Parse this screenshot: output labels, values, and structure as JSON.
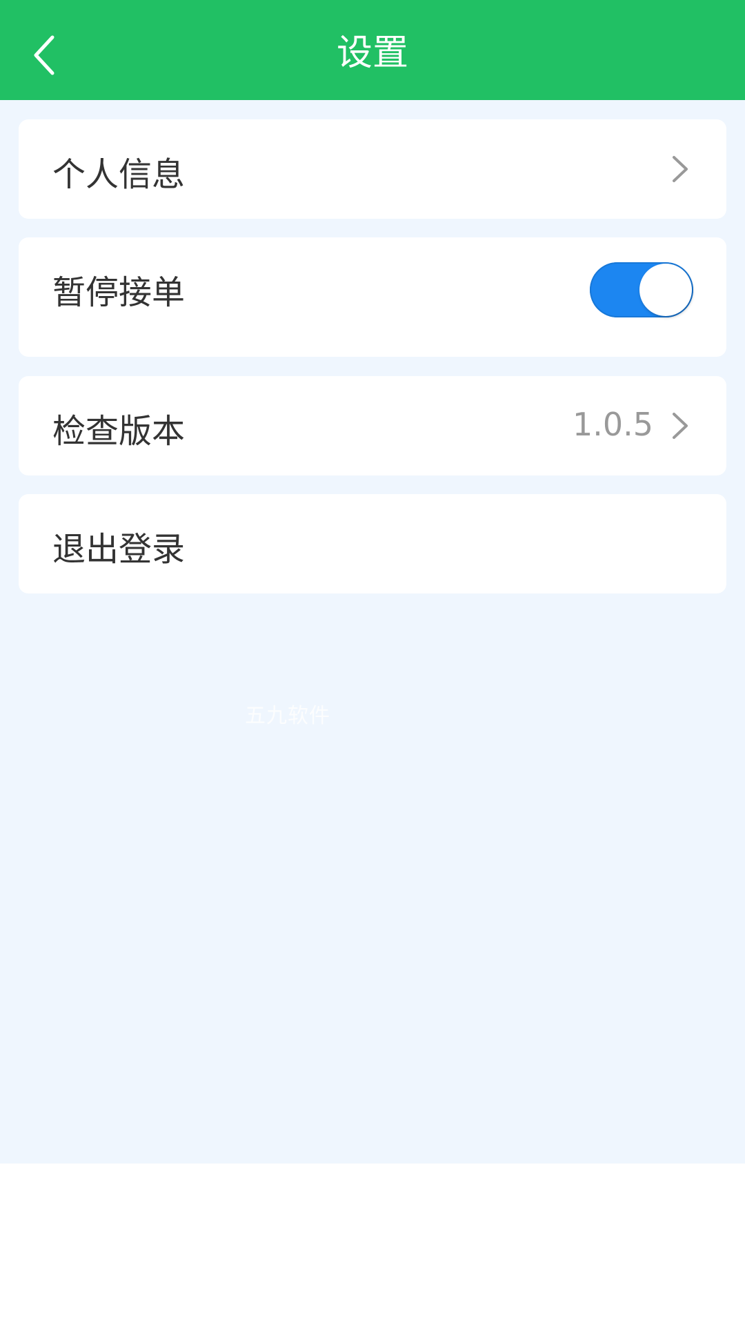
{
  "header": {
    "title": "设置",
    "back_icon": "chevron-left-icon",
    "background_color": "#21c064"
  },
  "settings": {
    "personal_info": {
      "label": "个人信息",
      "icon": "chevron-right-icon"
    },
    "pause_orders": {
      "label": "暂停接单",
      "toggle_on": true,
      "toggle_color": "#1c86f1"
    },
    "check_version": {
      "label": "检查版本",
      "value": "1.0.5",
      "icon": "chevron-right-icon"
    },
    "logout": {
      "label": "退出登录"
    }
  },
  "watermark": "五九软件",
  "colors": {
    "page_background": "#eff6fe",
    "card_background": "#ffffff",
    "label_text": "#333333",
    "secondary_text": "#999999"
  }
}
